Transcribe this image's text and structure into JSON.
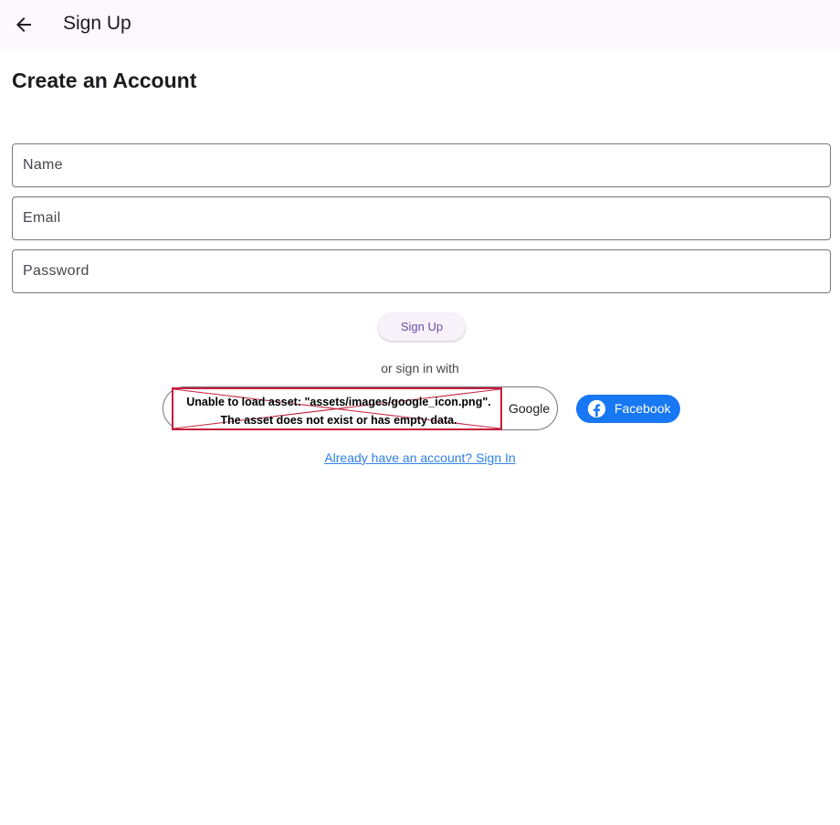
{
  "appbar": {
    "title": "Sign Up",
    "back_icon": "arrow-back-icon"
  },
  "page": {
    "heading": "Create an Account"
  },
  "form": {
    "name_placeholder": "Name",
    "email_placeholder": "Email",
    "password_placeholder": "Password",
    "name_value": "",
    "email_value": "",
    "password_value": "",
    "submit_label": "Sign Up"
  },
  "social": {
    "divider_text": "or sign in with",
    "google": {
      "label": "Google",
      "asset_error_line1": "Unable to load asset: \"assets/images/google_icon.png\".",
      "asset_error_line2": "The asset does not exist or has empty data."
    },
    "facebook": {
      "label": "Facebook",
      "icon": "facebook-icon",
      "color": "#1877f2"
    }
  },
  "footer": {
    "signin_link": "Already have an account? Sign In"
  },
  "colors": {
    "primary": "#6750a4",
    "appbar_bg": "#fdf7fe",
    "link": "#2f80ed",
    "error_border": "#c41f3b"
  }
}
